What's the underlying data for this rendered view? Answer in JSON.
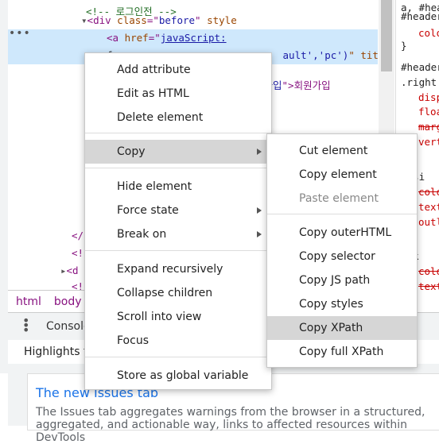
{
  "elements": {
    "lines": [
      {
        "t": "comment",
        "text": "<!-- 로그인전 -->"
      },
      {
        "t": "div",
        "tag": "div",
        "attr": "class",
        "val": "before",
        "rest": " style"
      },
      {
        "t": "a-open",
        "tag": "a",
        "attr1": "href",
        "link": "javaScript:"
      },
      {
        "t": "a-cont",
        "frag1": "f",
        "frag2": "ault','pc')",
        "frag3": "\" title="
      },
      {
        "t": "text",
        "frag": "원가입",
        "tail": "\">회원가입"
      }
    ],
    "lower": [
      {
        "text": "</"
      },
      {
        "text": "<!"
      },
      {
        "text": "<d"
      },
      {
        "text": "<!"
      }
    ],
    "dots": "•••"
  },
  "breadcrumb": [
    "html",
    "body"
  ],
  "styles_panel": {
    "lines": [
      {
        "kind": "ssel",
        "text": "a, #hea"
      },
      {
        "kind": "ssel",
        "text": "#header"
      },
      {
        "kind": "sprop",
        "text": "colo"
      },
      {
        "kind": "ssel",
        "text": "}"
      },
      {
        "kind": "ssel",
        "text": "#header"
      },
      {
        "kind": "ssel",
        "text": ".right"
      },
      {
        "kind": "sprop",
        "text": "disp"
      },
      {
        "kind": "sprop",
        "text": "floa"
      },
      {
        "kind": "sprop strike",
        "text": "marg"
      },
      {
        "kind": "sprop",
        "text": "vert"
      },
      {
        "kind": "ssel",
        "text": "visi"
      },
      {
        "kind": "sprop strike",
        "text": "colo"
      },
      {
        "kind": "sprop",
        "text": "text"
      },
      {
        "kind": "sprop",
        "text": "outl"
      },
      {
        "kind": "ssel",
        "text": "ink"
      },
      {
        "kind": "sprop strike",
        "text": "colo"
      },
      {
        "kind": "sprop strike",
        "text": "text"
      }
    ]
  },
  "drawer": {
    "tab": "Console"
  },
  "issues": {
    "highlights": "Highlights f",
    "title": "The new Issues tab",
    "desc": "The Issues tab aggregates warnings from the browser in a structured, aggregated, and actionable way, links to affected resources within DevTools"
  },
  "context_menu": {
    "items": [
      {
        "label": "Add attribute"
      },
      {
        "label": "Edit as HTML"
      },
      {
        "label": "Delete element"
      },
      {
        "label": "Copy",
        "submenu": true,
        "highlighted": true
      },
      {
        "label": "Hide element"
      },
      {
        "label": "Force state",
        "submenu": true
      },
      {
        "label": "Break on",
        "submenu": true
      },
      {
        "label": "Expand recursively"
      },
      {
        "label": "Collapse children"
      },
      {
        "label": "Scroll into view"
      },
      {
        "label": "Focus"
      },
      {
        "label": "Store as global variable"
      }
    ]
  },
  "copy_submenu": {
    "items": [
      {
        "label": "Cut element"
      },
      {
        "label": "Copy element"
      },
      {
        "label": "Paste element",
        "disabled": true
      },
      {
        "label": "Copy outerHTML"
      },
      {
        "label": "Copy selector"
      },
      {
        "label": "Copy JS path"
      },
      {
        "label": "Copy styles"
      },
      {
        "label": "Copy XPath",
        "highlighted": true
      },
      {
        "label": "Copy full XPath"
      }
    ]
  },
  "colors": {
    "tag": "#881280",
    "attr": "#994500",
    "value": "#1a1aa6",
    "comment": "#236e25",
    "selected_row": "#cfe8fc",
    "menu_highlight": "#d6d6d6",
    "link_blue": "#1a73e8"
  }
}
